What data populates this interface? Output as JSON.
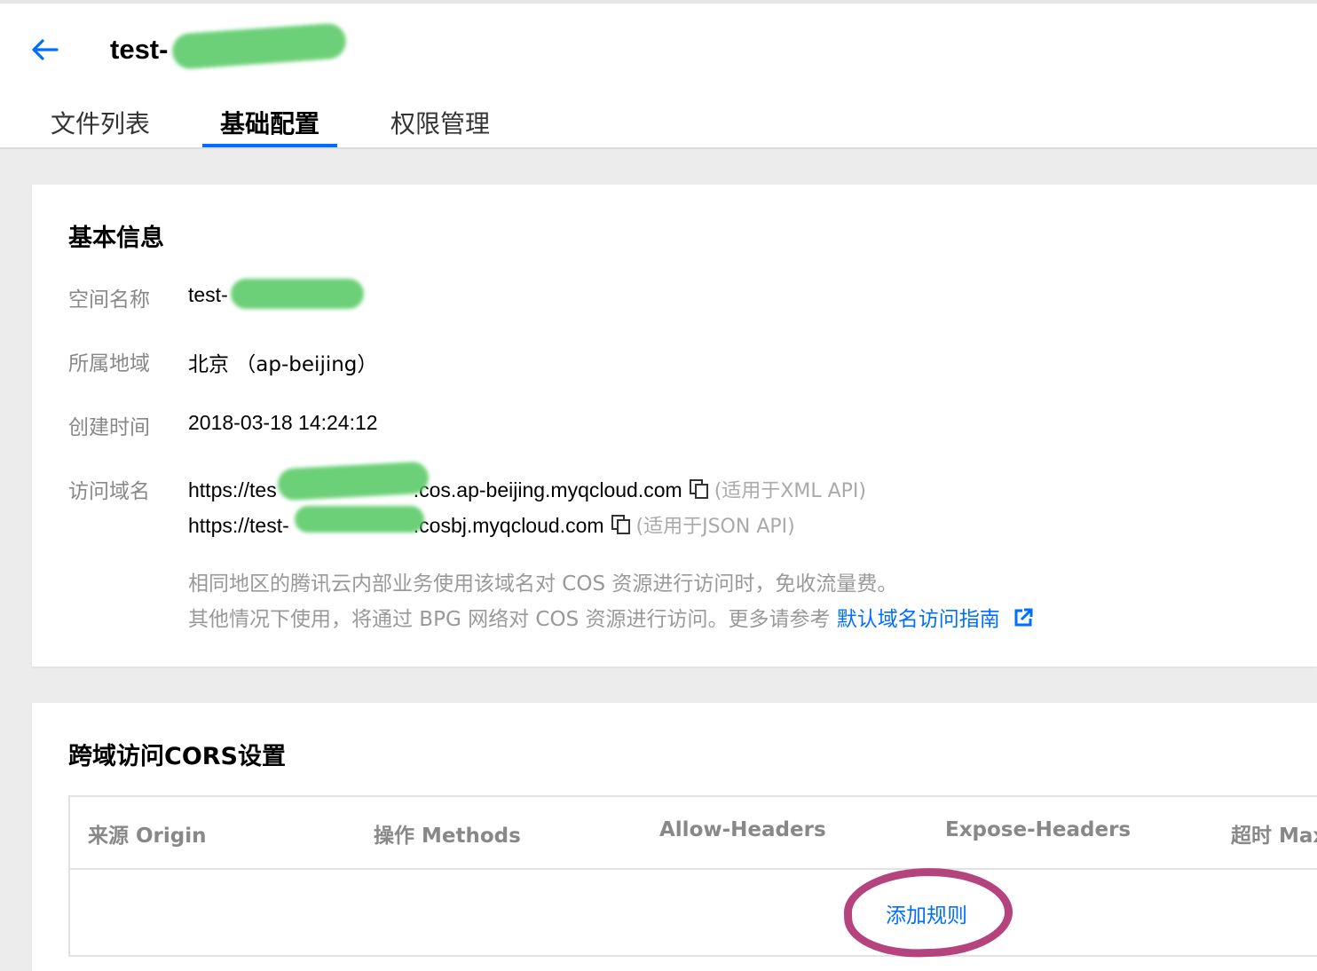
{
  "header": {
    "title": "test-",
    "tabs": [
      {
        "label": "文件列表",
        "active": false
      },
      {
        "label": "基础配置",
        "active": true
      },
      {
        "label": "权限管理",
        "active": false
      }
    ]
  },
  "basic_info": {
    "section_title": "基本信息",
    "rows": {
      "space_name": {
        "label": "空间名称",
        "value": "test-"
      },
      "region": {
        "label": "所属地域",
        "value": "北京 （ap-beijing）"
      },
      "created": {
        "label": "创建时间",
        "value": "2018-03-18 14:24:12"
      },
      "domain": {
        "label": "访问域名",
        "xml": {
          "prefix": "https://tes",
          "suffix": ".cos.ap-beijing.myqcloud.com",
          "hint": "(适用于XML API)"
        },
        "json": {
          "prefix": "https://test-",
          "suffix": ".cosbj.myqcloud.com",
          "hint": "(适用于JSON API)"
        },
        "note_line1": "相同地区的腾讯云内部业务使用该域名对 COS 资源进行访问时，免收流量费。",
        "note_line2": "其他情况下使用，将通过 BPG 网络对 COS 资源进行访问。更多请参考",
        "guide_link": "默认域名访问指南"
      }
    }
  },
  "cors": {
    "section_title": "跨域访问CORS设置",
    "columns": [
      "来源 Origin",
      "操作 Methods",
      "Allow-Headers",
      "Expose-Headers",
      "超时 Max"
    ],
    "add_rule": "添加规则"
  },
  "colors": {
    "accent": "#006eff",
    "annotation": "#b5437e",
    "redaction": "#5dcb6a"
  }
}
